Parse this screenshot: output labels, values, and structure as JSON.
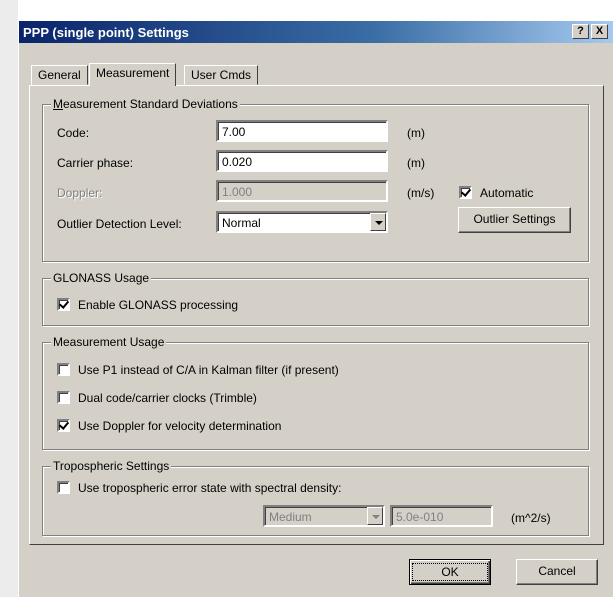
{
  "window": {
    "title": "PPP (single point) Settings",
    "help_label": "?",
    "close_label": "X"
  },
  "tabs": [
    {
      "label": "General"
    },
    {
      "label": "Measurement"
    },
    {
      "label": "User Cmds"
    }
  ],
  "std_dev": {
    "group_label": "Measurement Standard Deviations",
    "code_label": "Code:",
    "code_value": "7.00",
    "code_unit": "(m)",
    "carrier_label": "Carrier phase:",
    "carrier_value": "0.020",
    "carrier_unit": "(m)",
    "doppler_label": "Doppler:",
    "doppler_value": "1.000",
    "doppler_unit": "(m/s)",
    "automatic_label": "Automatic",
    "automatic_checked": true,
    "outlier_label": "Outlier Detection Level:",
    "outlier_value": "Normal",
    "outlier_button": "Outlier Settings"
  },
  "glonass": {
    "group_label": "GLONASS Usage",
    "enable_label": "Enable GLONASS processing",
    "enable_checked": true
  },
  "usage": {
    "group_label": "Measurement Usage",
    "p1_label": "Use P1 instead of C/A in Kalman filter (if present)",
    "p1_checked": false,
    "dual_label": "Dual code/carrier clocks (Trimble)",
    "dual_checked": false,
    "doppler_label": "Use Doppler for velocity determination",
    "doppler_checked": true
  },
  "tropo": {
    "group_label": "Tropospheric Settings",
    "state_label": "Use tropospheric error state with spectral density:",
    "state_checked": false,
    "density_value": "Medium",
    "density_number": "5.0e-010",
    "density_unit": "(m^2/s)"
  },
  "footer": {
    "ok_label": "OK",
    "cancel_label": "Cancel"
  }
}
